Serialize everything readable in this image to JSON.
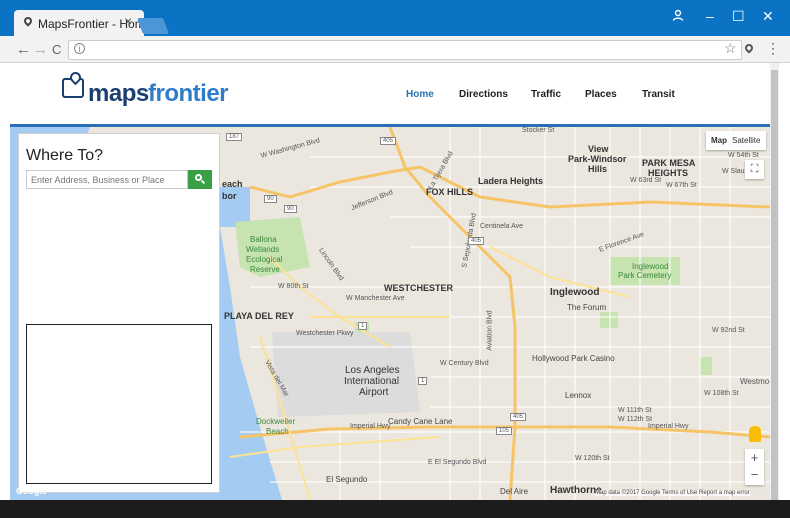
{
  "browser": {
    "tab_title": "MapsFrontier - Home",
    "tab_close": "×",
    "window_controls": [
      "–",
      "☐",
      "✕"
    ],
    "nav_glyphs": [
      "←",
      "→",
      "C"
    ],
    "info_glyph": "i",
    "star_glyph": "☆",
    "menu_glyph": "⋮"
  },
  "site": {
    "logo_a": "maps",
    "logo_b": "frontier",
    "nav": [
      "Home",
      "Directions",
      "Traffic",
      "Places",
      "Transit"
    ]
  },
  "sidebar": {
    "title": "Where To?",
    "search_placeholder": "Enter Address, Business or Place"
  },
  "map": {
    "type_buttons": [
      "Map",
      "Satellite"
    ],
    "fullscreen_glyph": "⛶",
    "zoom_in": "+",
    "zoom_out": "−",
    "attribution": "Map data ©2017 Google   Terms of Use   Report a map error",
    "google_logo": "Google",
    "labels": {
      "stocker": "Stocker St",
      "view_park": "View",
      "park_windsor": "Park-Windsor",
      "hills": "Hills",
      "park_mesa": "PARK MESA",
      "heights": "HEIGHTS",
      "w54": "W 54th St",
      "slauson": "W Slauson",
      "washington": "W Washington Blvd",
      "fox_hills": "FOX HILLS",
      "ladera": "Ladera Heights",
      "w63": "W 63rd St",
      "w67": "W 67th St",
      "each": "each",
      "bor": "bor",
      "jefferson": "Jefferson Blvd",
      "centinela": "Centinela Ave",
      "florence": "E Florence Ave",
      "ballona1": "Ballona",
      "ballona2": "Wetlands",
      "ballona3": "Ecological",
      "ballona4": "Reserve",
      "inglewood_cem1": "Inglewood",
      "inglewood_cem2": "Park Cemetery",
      "w80": "W 80th St",
      "westchester": "WESTCHESTER",
      "inglewood": "Inglewood",
      "manchester": "W Manchester Ave",
      "playa": "PLAYA DEL REY",
      "forum": "The Forum",
      "westchester_pkwy": "Westchester Pkwy",
      "w92": "W 92nd St",
      "century": "W Century Blvd",
      "casino": "Hollywood Park Casino",
      "lax1": "Los Angeles",
      "lax2": "International",
      "lax3": "Airport",
      "westmo": "Westmo",
      "lennox": "Lennox",
      "w108": "W 108th St",
      "w111": "W 111th St",
      "w112": "W 112th St",
      "candy": "Candy Cane Lane",
      "imperial": "Imperial Hwy",
      "dockweiler1": "Dockweiler",
      "dockweiler2": "Beach",
      "el_segundo_blvd": "E El Segundo Blvd",
      "w120": "W 120th St",
      "el_segundo": "El Segundo",
      "del_aire": "Del Aire",
      "hawthorne": "Hawthorne",
      "vista": "Vista del Mar",
      "lincoln": "Lincoln Blvd",
      "la_tijera": "La Tijera Blvd",
      "sepulveda": "S Sepulveda Blvd",
      "aviation": "Aviation Blvd"
    },
    "shields": [
      "405",
      "405",
      "405",
      "105",
      "90",
      "90",
      "1",
      "1",
      "187"
    ]
  }
}
